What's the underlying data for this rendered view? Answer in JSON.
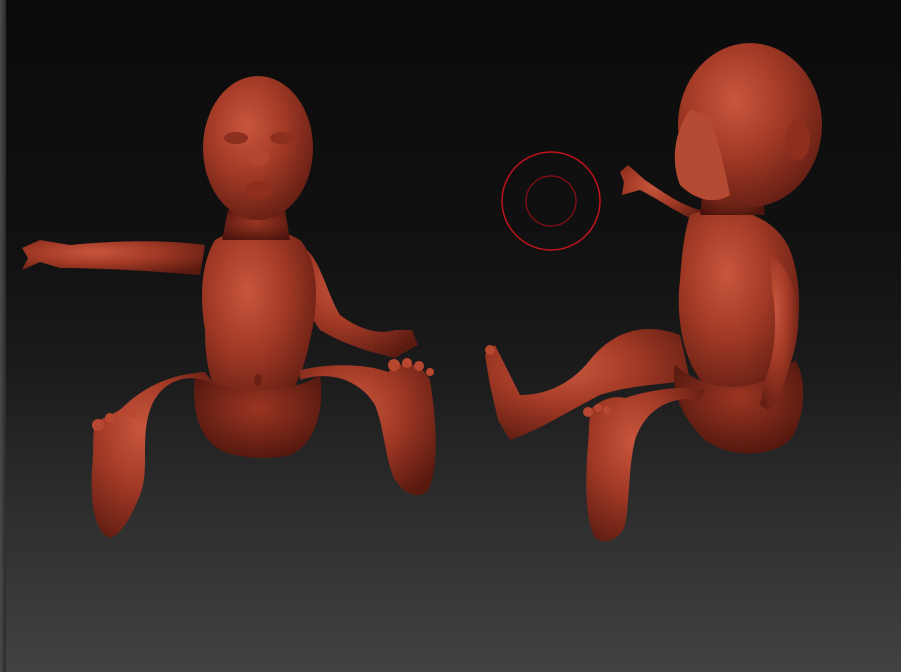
{
  "viewport": {
    "material_color": "#a33a26",
    "brush_cursor_color": "#c0141a",
    "background_top": "#0b0b0b",
    "background_bottom": "#424242"
  },
  "scene": {
    "models": [
      "baby-sculpt-front",
      "baby-sculpt-side"
    ]
  }
}
